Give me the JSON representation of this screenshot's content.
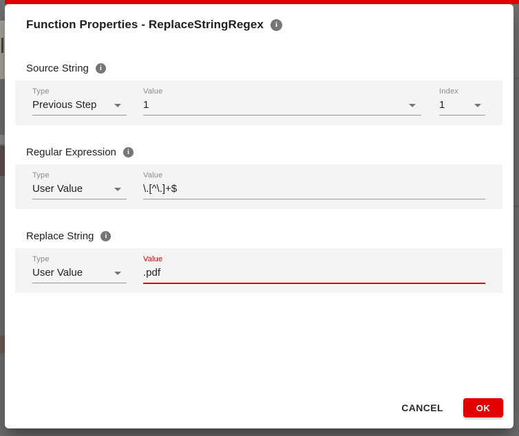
{
  "colors": {
    "accent_red": "#e30000",
    "error_red": "#d50000",
    "panel_bg": "#f4f4f4",
    "scrim_gray": "#6f6f6f"
  },
  "icons": {
    "info": "i"
  },
  "dialog": {
    "title": "Function Properties - ReplaceStringRegex",
    "sections": [
      {
        "heading": "Source String",
        "fields": {
          "type": {
            "label": "Type",
            "value": "Previous Step"
          },
          "value": {
            "label": "Value",
            "value": "1"
          },
          "index": {
            "label": "Index",
            "value": "1"
          }
        }
      },
      {
        "heading": "Regular Expression",
        "fields": {
          "type": {
            "label": "Type",
            "value": "User Value"
          },
          "value": {
            "label": "Value",
            "value": "\\.[^\\.]+$"
          }
        }
      },
      {
        "heading": "Replace String",
        "fields": {
          "type": {
            "label": "Type",
            "value": "User Value"
          },
          "value": {
            "label": "Value",
            "value": ".pdf"
          }
        }
      }
    ],
    "actions": {
      "cancel_label": "CANCEL",
      "ok_label": "OK"
    }
  }
}
